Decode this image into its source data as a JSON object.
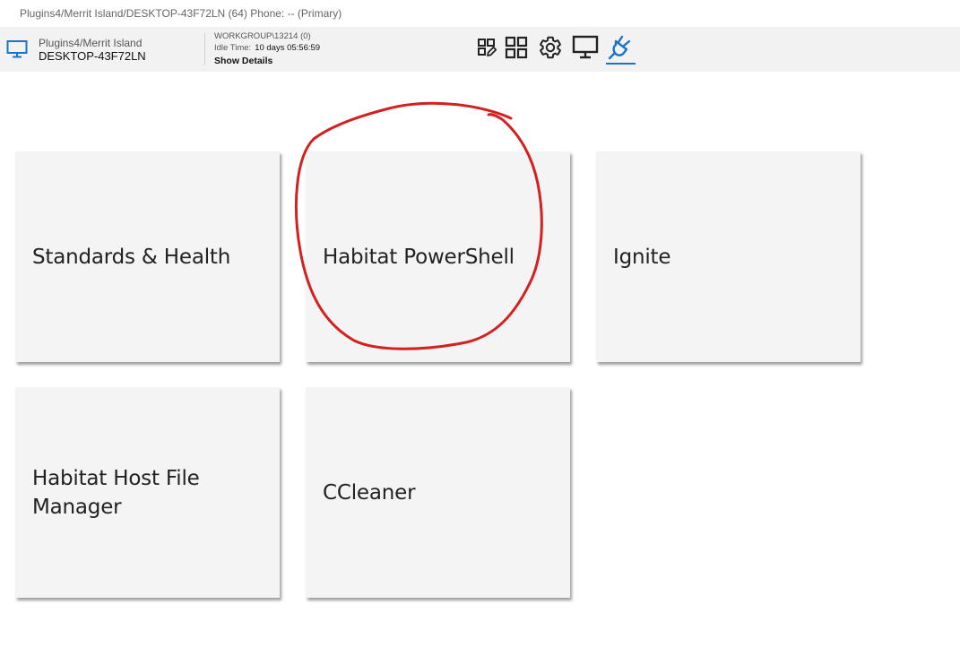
{
  "window": {
    "title": "Plugins4/Merrit Island/DESKTOP-43F72LN (64) Phone: -- (Primary)"
  },
  "header": {
    "machine_path": "Plugins4/Merrit Island",
    "machine_name": "DESKTOP-43F72LN",
    "workgroup": "WORKGROUP\\13214 (0)",
    "idle_label": "Idle Time:",
    "idle_value": "10 days 05:56:59",
    "show_details_label": "Show Details",
    "toolbar": [
      {
        "icon": "edit-grid-icon"
      },
      {
        "icon": "apps-grid-icon"
      },
      {
        "icon": "gear-icon"
      },
      {
        "icon": "monitor-icon"
      },
      {
        "icon": "plug-icon",
        "active": true
      }
    ]
  },
  "tiles": [
    {
      "label": "Standards & Health"
    },
    {
      "label": "Habitat PowerShell"
    },
    {
      "label": "Ignite"
    },
    {
      "label": "Habitat Host File Manager"
    },
    {
      "label": "CCleaner"
    }
  ],
  "colors": {
    "accent": "#1a73c9",
    "annotation": "#d42020",
    "tile_bg": "#f4f4f4",
    "header_bg": "#f2f2f2"
  }
}
